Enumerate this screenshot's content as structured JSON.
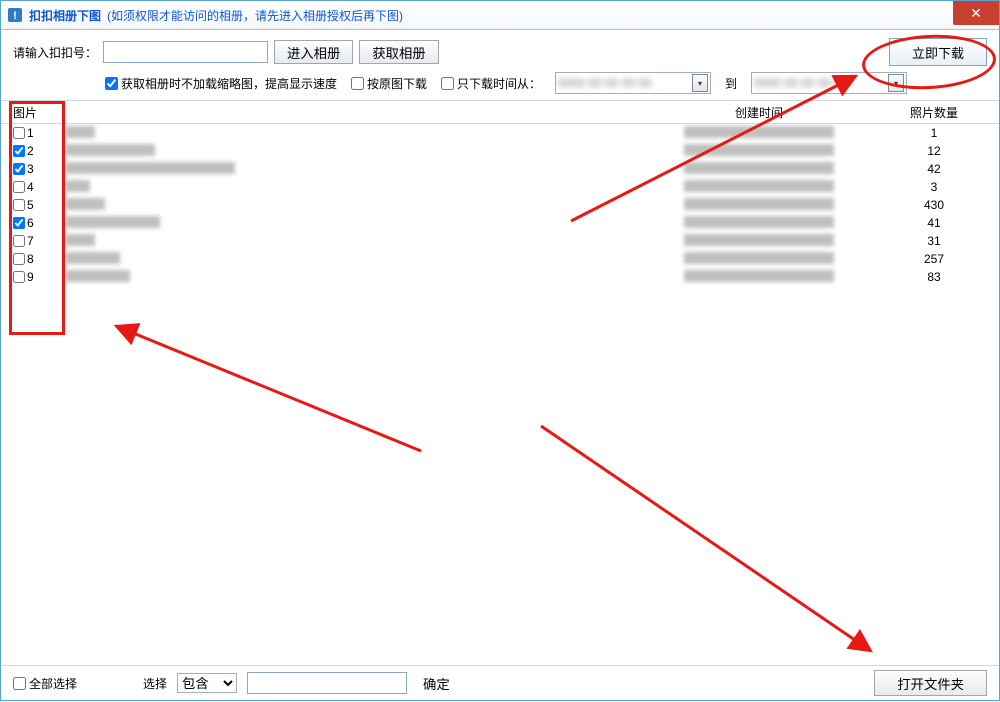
{
  "title": {
    "app": "扣扣相册下图",
    "note": "(如须权限才能访问的相册，请先进入相册授权后再下图)"
  },
  "toolbar": {
    "id_label": "请输入扣扣号：",
    "id_value": "",
    "enter_album": "进入相册",
    "get_album": "获取相册",
    "download_now": "立即下载"
  },
  "options": {
    "no_thumb": {
      "checked": true,
      "label": "获取相册时不加载缩略图，提高显示速度"
    },
    "by_original": {
      "checked": false,
      "label": "按原图下载"
    },
    "only_time": {
      "checked": false,
      "label": "只下载时间从："
    },
    "to_label": "到",
    "from_value": "",
    "to_value": ""
  },
  "columns": {
    "pic": "图片",
    "time": "创建时间",
    "count": "照片数量"
  },
  "rows": [
    {
      "idx": "1",
      "checked": false,
      "name_w": 30,
      "time_w": 150,
      "count": "1"
    },
    {
      "idx": "2",
      "checked": true,
      "name_w": 90,
      "time_w": 150,
      "count": "12"
    },
    {
      "idx": "3",
      "checked": true,
      "name_w": 170,
      "time_w": 150,
      "count": "42"
    },
    {
      "idx": "4",
      "checked": false,
      "name_w": 25,
      "time_w": 150,
      "count": "3"
    },
    {
      "idx": "5",
      "checked": false,
      "name_w": 40,
      "time_w": 150,
      "count": "430"
    },
    {
      "idx": "6",
      "checked": true,
      "name_w": 95,
      "time_w": 150,
      "count": "41"
    },
    {
      "idx": "7",
      "checked": false,
      "name_w": 30,
      "time_w": 150,
      "count": "31"
    },
    {
      "idx": "8",
      "checked": false,
      "name_w": 55,
      "time_w": 150,
      "count": "257"
    },
    {
      "idx": "9",
      "checked": false,
      "name_w": 65,
      "time_w": 150,
      "count": "83"
    }
  ],
  "bottom": {
    "select_all": {
      "checked": false,
      "label": "全部选择"
    },
    "select_label": "选择",
    "combo_options": [
      "包含"
    ],
    "combo_value": "包含",
    "filter_value": "",
    "ok": "确定",
    "open_folder": "打开文件夹"
  }
}
